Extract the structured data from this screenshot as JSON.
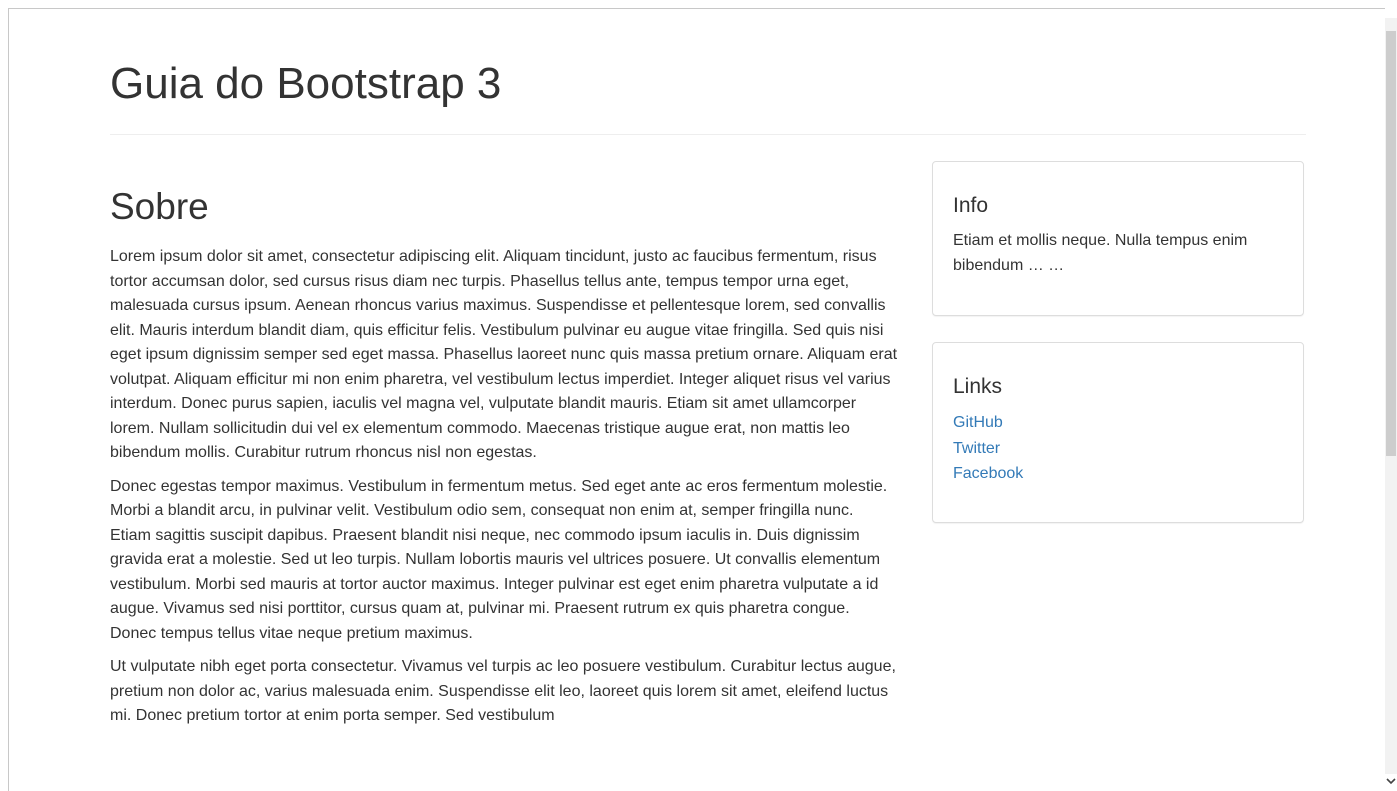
{
  "header": {
    "title": "Guia do Bootstrap 3"
  },
  "main": {
    "heading": "Sobre",
    "paragraphs": [
      "Lorem ipsum dolor sit amet, consectetur adipiscing elit. Aliquam tincidunt, justo ac faucibus fermentum, risus tortor accumsan dolor, sed cursus risus diam nec turpis. Phasellus tellus ante, tempus tempor urna eget, malesuada cursus ipsum. Aenean rhoncus varius maximus. Suspendisse et pellentesque lorem, sed convallis elit. Mauris interdum blandit diam, quis efficitur felis. Vestibulum pulvinar eu augue vitae fringilla. Sed quis nisi eget ipsum dignissim semper sed eget massa. Phasellus laoreet nunc quis massa pretium ornare. Aliquam erat volutpat. Aliquam efficitur mi non enim pharetra, vel vestibulum lectus imperdiet. Integer aliquet risus vel varius interdum. Donec purus sapien, iaculis vel magna vel, vulputate blandit mauris. Etiam sit amet ullamcorper lorem. Nullam sollicitudin dui vel ex elementum commodo. Maecenas tristique augue erat, non mattis leo bibendum mollis. Curabitur rutrum rhoncus nisl non egestas.",
      "Donec egestas tempor maximus. Vestibulum in fermentum metus. Sed eget ante ac eros fermentum molestie. Morbi a blandit arcu, in pulvinar velit. Vestibulum odio sem, consequat non enim at, semper fringilla nunc. Etiam sagittis suscipit dapibus. Praesent blandit nisi neque, nec commodo ipsum iaculis in. Duis dignissim gravida erat a molestie. Sed ut leo turpis. Nullam lobortis mauris vel ultrices posuere. Ut convallis elementum vestibulum. Morbi sed mauris at tortor auctor maximus. Integer pulvinar est eget enim pharetra vulputate a id augue. Vivamus sed nisi porttitor, cursus quam at, pulvinar mi. Praesent rutrum ex quis pharetra congue. Donec tempus tellus vitae neque pretium maximus.",
      "Ut vulputate nibh eget porta consectetur. Vivamus vel turpis ac leo posuere vestibulum. Curabitur lectus augue, pretium non dolor ac, varius malesuada enim. Suspendisse elit leo, laoreet quis lorem sit amet, eleifend luctus mi. Donec pretium tortor at enim porta semper. Sed vestibulum"
    ]
  },
  "sidebar": {
    "info": {
      "title": "Info",
      "text": "Etiam et mollis neque. Nulla tempus enim bibendum … …"
    },
    "links": {
      "title": "Links",
      "items": [
        "GitHub",
        "Twitter",
        "Facebook"
      ]
    }
  },
  "colors": {
    "text": "#333333",
    "link": "#337ab7",
    "border": "#dddddd",
    "divider": "#eeeeee"
  },
  "icons": {
    "scroll_up": "chevron-up-icon",
    "scroll_down": "chevron-down-icon"
  }
}
